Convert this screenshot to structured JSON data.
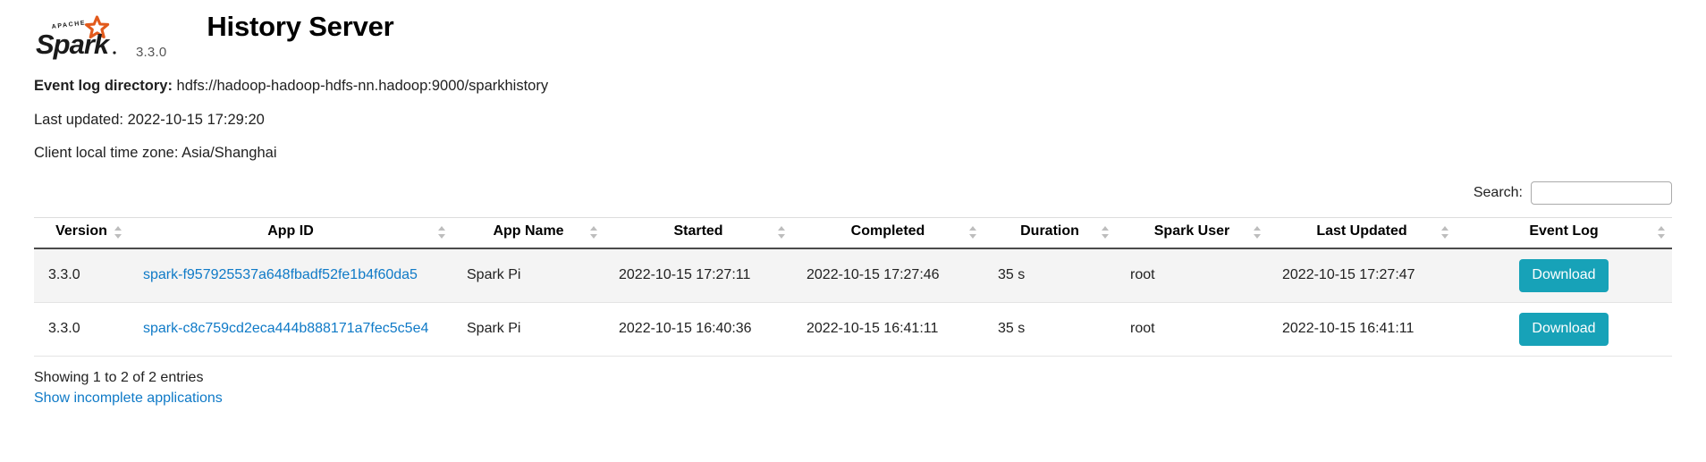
{
  "header": {
    "logo_apache_text": "APACHE",
    "logo_spark_text": "Spark",
    "logo_version": "3.3.0",
    "title": "History Server",
    "brand_color": "#e25a1c"
  },
  "info": {
    "event_log_label": "Event log directory:",
    "event_log_value": "hdfs://hadoop-hadoop-hdfs-nn.hadoop:9000/sparkhistory",
    "last_updated": "Last updated: 2022-10-15 17:29:20",
    "time_zone": "Client local time zone: Asia/Shanghai"
  },
  "search": {
    "label": "Search:",
    "value": "",
    "placeholder": ""
  },
  "table": {
    "columns": [
      {
        "label": "Version",
        "sortable": true
      },
      {
        "label": "App ID",
        "sortable": true
      },
      {
        "label": "App Name",
        "sortable": true
      },
      {
        "label": "Started",
        "sortable": true
      },
      {
        "label": "Completed",
        "sortable": true
      },
      {
        "label": "Duration",
        "sortable": true
      },
      {
        "label": "Spark User",
        "sortable": true
      },
      {
        "label": "Last Updated",
        "sortable": true
      },
      {
        "label": "Event Log",
        "sortable": true
      }
    ],
    "rows": [
      {
        "version": "3.3.0",
        "app_id": "spark-f957925537a648fbadf52fe1b4f60da5",
        "app_name": "Spark Pi",
        "started": "2022-10-15 17:27:11",
        "completed": "2022-10-15 17:27:46",
        "duration": "35 s",
        "spark_user": "root",
        "last_updated": "2022-10-15 17:27:47",
        "event_log_label": "Download"
      },
      {
        "version": "3.3.0",
        "app_id": "spark-c8c759cd2eca444b888171a7fec5c5e4",
        "app_name": "Spark Pi",
        "started": "2022-10-15 16:40:36",
        "completed": "2022-10-15 16:41:11",
        "duration": "35 s",
        "spark_user": "root",
        "last_updated": "2022-10-15 16:41:11",
        "event_log_label": "Download"
      }
    ]
  },
  "footer": {
    "showing_entries": "Showing 1 to 2 of 2 entries",
    "incomplete_link": "Show incomplete applications"
  },
  "colors": {
    "link": "#0f7ac7",
    "download_button": "#17a2b8",
    "row_stripe": "#f4f4f4",
    "header_rule": "#4a4a4a"
  }
}
